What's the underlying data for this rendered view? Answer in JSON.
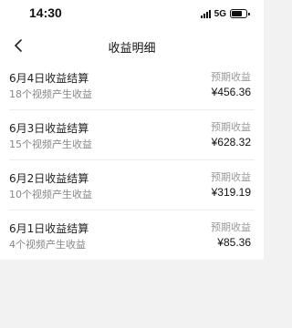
{
  "status_bar": {
    "time": "14:30",
    "network": "5G",
    "icons": [
      "signal-icon",
      "battery-icon"
    ]
  },
  "nav": {
    "title": "收益明细",
    "back_icon": "chevron-left-icon"
  },
  "records": [
    {
      "title": "6月4日收益结算",
      "subtitle": "18个视频产生收益",
      "label": "预期收益",
      "amount": "¥456.36"
    },
    {
      "title": "6月3日收益结算",
      "subtitle": "15个视频产生收益",
      "label": "预期收益",
      "amount": "¥628.32"
    },
    {
      "title": "6月2日收益结算",
      "subtitle": "10个视频产生收益",
      "label": "预期收益",
      "amount": "¥319.19"
    },
    {
      "title": "6月1日收益结算",
      "subtitle": "4个视频产生收益",
      "label": "预期收益",
      "amount": "¥85.36"
    }
  ],
  "colors": {
    "background": "#f2f2f2",
    "card": "#ffffff",
    "primary_text": "#222222",
    "secondary_text": "#888888"
  }
}
